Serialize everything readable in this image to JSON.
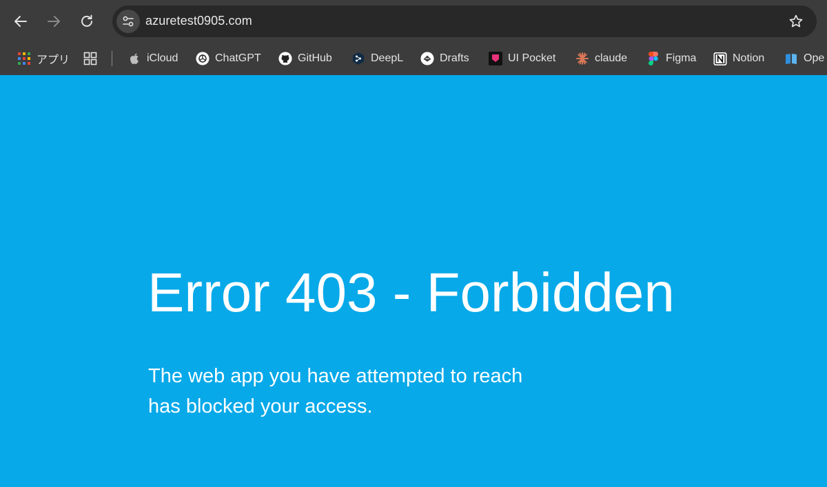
{
  "browser": {
    "url": "azuretest0905.com"
  },
  "icons": {
    "back": "arrow-left-icon",
    "forward": "arrow-right-icon",
    "reload": "reload-icon",
    "site_info": "tune-icon",
    "bookmark_star": "star-icon"
  },
  "bookmarks": [
    {
      "label": "アプリ",
      "icon": "apps-grid-icon"
    },
    {
      "label": "",
      "icon": "tab-groups-icon"
    },
    {
      "label": "iCloud",
      "icon": "apple-icon"
    },
    {
      "label": "ChatGPT",
      "icon": "chatgpt-icon"
    },
    {
      "label": "GitHub",
      "icon": "github-icon"
    },
    {
      "label": "DeepL",
      "icon": "deepl-icon"
    },
    {
      "label": "Drafts",
      "icon": "drafts-icon"
    },
    {
      "label": "UI Pocket",
      "icon": "ui-pocket-icon"
    },
    {
      "label": "claude",
      "icon": "claude-icon"
    },
    {
      "label": "Figma",
      "icon": "figma-icon"
    },
    {
      "label": "Notion",
      "icon": "notion-icon"
    },
    {
      "label": "Ope",
      "icon": "book-icon"
    }
  ],
  "page": {
    "title": "Error 403 - Forbidden",
    "message": "The web app you have attempted to reach has blocked your access."
  },
  "colors": {
    "page_background": "#07a9e9",
    "chrome_background": "#3c3c3c",
    "omnibox_background": "#282828",
    "text_on_page": "#ffffff"
  }
}
